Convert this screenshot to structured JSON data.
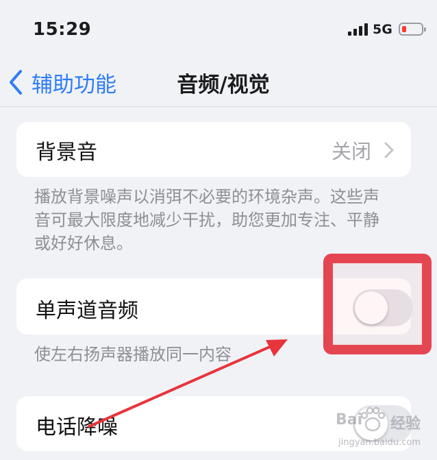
{
  "status_bar": {
    "time": "15:29",
    "network": "5G"
  },
  "nav": {
    "back_label": "辅助功能",
    "title": "音频/视觉"
  },
  "background_sounds": {
    "label": "背景音",
    "value": "关闭"
  },
  "background_desc": [
    "播放背景噪声以消弭不必要的环境杂声。这些声",
    "音可最大限度地减少干扰，助您更加专注、平静",
    "或好好休息。"
  ],
  "mono_audio": {
    "label": "单声道音频",
    "on": false,
    "desc": "使左右扬声器播放同一内容"
  },
  "phone_noise": {
    "label": "电话降噪"
  },
  "watermark": {
    "brand_a": "Bai",
    "brand_b": "经验",
    "url": "jingyan.baidu.com"
  },
  "colors": {
    "accent": "#2f7cf6",
    "highlight": "#e54551",
    "arrow": "#e8343a",
    "battery_low": "#ff3b30"
  }
}
